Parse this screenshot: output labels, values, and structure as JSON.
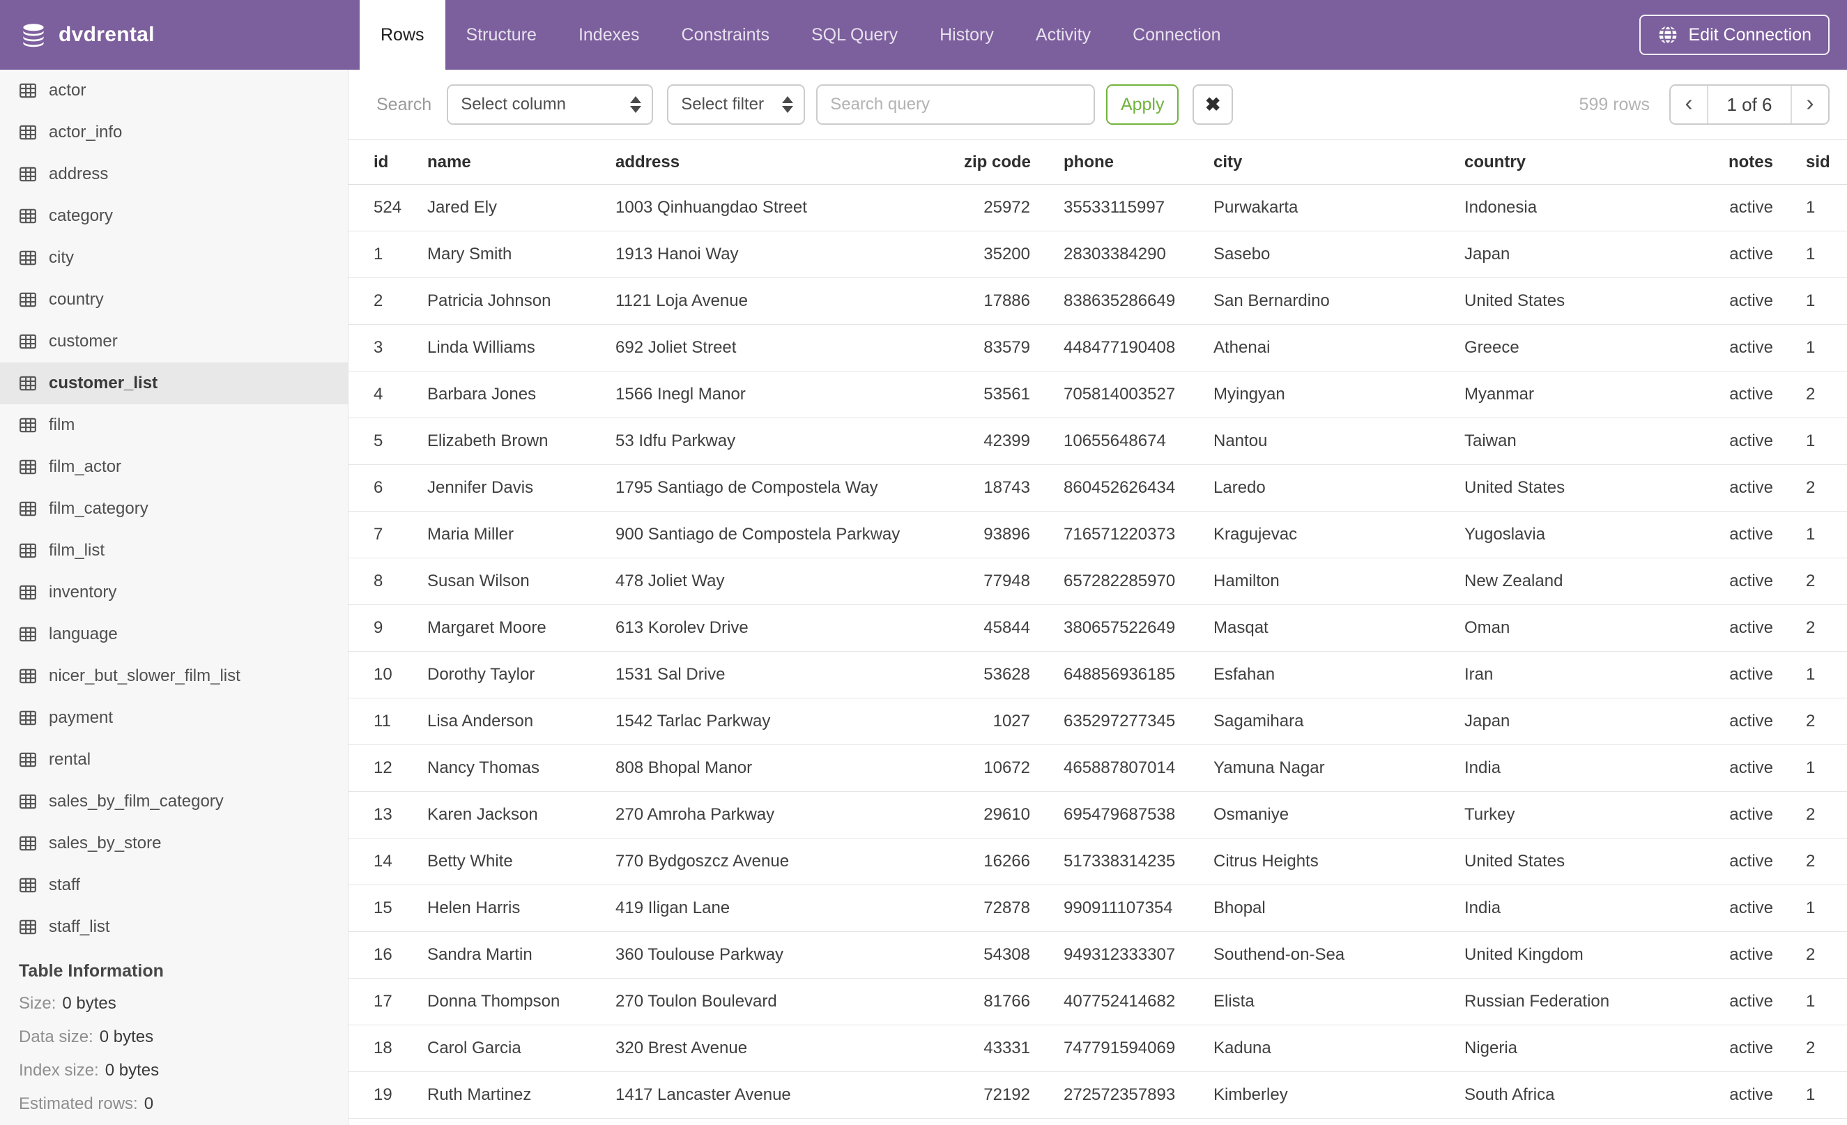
{
  "app": {
    "database_name": "dvdrental"
  },
  "topbar": {
    "tabs": [
      "Rows",
      "Structure",
      "Indexes",
      "Constraints",
      "SQL Query",
      "History",
      "Activity",
      "Connection"
    ],
    "active_tab": "Rows",
    "edit_connection_label": "Edit Connection"
  },
  "sidebar": {
    "tables": [
      "actor",
      "actor_info",
      "address",
      "category",
      "city",
      "country",
      "customer",
      "customer_list",
      "film",
      "film_actor",
      "film_category",
      "film_list",
      "inventory",
      "language",
      "nicer_but_slower_film_list",
      "payment",
      "rental",
      "sales_by_film_category",
      "sales_by_store",
      "staff",
      "staff_list"
    ],
    "selected_table": "customer_list",
    "info": {
      "title": "Table Information",
      "items": [
        {
          "label": "Size:",
          "value": "0 bytes"
        },
        {
          "label": "Data size:",
          "value": "0 bytes"
        },
        {
          "label": "Index size:",
          "value": "0 bytes"
        },
        {
          "label": "Estimated rows:",
          "value": "0"
        }
      ]
    }
  },
  "toolbar": {
    "search_label": "Search",
    "column_select_value": "Select column",
    "filter_select_value": "Select filter",
    "query_placeholder": "Search query",
    "query_value": "",
    "apply_label": "Apply",
    "clear_label": "✖",
    "rows_count": "599 rows",
    "page_indicator": "1 of 6",
    "prev_label": "‹",
    "next_label": "›"
  },
  "grid": {
    "columns": [
      "id",
      "name",
      "address",
      "zip code",
      "phone",
      "city",
      "country",
      "notes",
      "sid"
    ],
    "rows": [
      [
        "524",
        "Jared Ely",
        "1003 Qinhuangdao Street",
        "25972",
        "35533115997",
        "Purwakarta",
        "Indonesia",
        "active",
        "1"
      ],
      [
        "1",
        "Mary Smith",
        "1913 Hanoi Way",
        "35200",
        "28303384290",
        "Sasebo",
        "Japan",
        "active",
        "1"
      ],
      [
        "2",
        "Patricia Johnson",
        "1121 Loja Avenue",
        "17886",
        "838635286649",
        "San Bernardino",
        "United States",
        "active",
        "1"
      ],
      [
        "3",
        "Linda Williams",
        "692 Joliet Street",
        "83579",
        "448477190408",
        "Athenai",
        "Greece",
        "active",
        "1"
      ],
      [
        "4",
        "Barbara Jones",
        "1566 Inegl Manor",
        "53561",
        "705814003527",
        "Myingyan",
        "Myanmar",
        "active",
        "2"
      ],
      [
        "5",
        "Elizabeth Brown",
        "53 Idfu Parkway",
        "42399",
        "10655648674",
        "Nantou",
        "Taiwan",
        "active",
        "1"
      ],
      [
        "6",
        "Jennifer Davis",
        "1795 Santiago de Compostela Way",
        "18743",
        "860452626434",
        "Laredo",
        "United States",
        "active",
        "2"
      ],
      [
        "7",
        "Maria Miller",
        "900 Santiago de Compostela Parkway",
        "93896",
        "716571220373",
        "Kragujevac",
        "Yugoslavia",
        "active",
        "1"
      ],
      [
        "8",
        "Susan Wilson",
        "478 Joliet Way",
        "77948",
        "657282285970",
        "Hamilton",
        "New Zealand",
        "active",
        "2"
      ],
      [
        "9",
        "Margaret Moore",
        "613 Korolev Drive",
        "45844",
        "380657522649",
        "Masqat",
        "Oman",
        "active",
        "2"
      ],
      [
        "10",
        "Dorothy Taylor",
        "1531 Sal Drive",
        "53628",
        "648856936185",
        "Esfahan",
        "Iran",
        "active",
        "1"
      ],
      [
        "11",
        "Lisa Anderson",
        "1542 Tarlac Parkway",
        "1027",
        "635297277345",
        "Sagamihara",
        "Japan",
        "active",
        "2"
      ],
      [
        "12",
        "Nancy Thomas",
        "808 Bhopal Manor",
        "10672",
        "465887807014",
        "Yamuna Nagar",
        "India",
        "active",
        "1"
      ],
      [
        "13",
        "Karen Jackson",
        "270 Amroha Parkway",
        "29610",
        "695479687538",
        "Osmaniye",
        "Turkey",
        "active",
        "2"
      ],
      [
        "14",
        "Betty White",
        "770 Bydgoszcz Avenue",
        "16266",
        "517338314235",
        "Citrus Heights",
        "United States",
        "active",
        "2"
      ],
      [
        "15",
        "Helen Harris",
        "419 Iligan Lane",
        "72878",
        "990911107354",
        "Bhopal",
        "India",
        "active",
        "1"
      ],
      [
        "16",
        "Sandra Martin",
        "360 Toulouse Parkway",
        "54308",
        "949312333307",
        "Southend-on-Sea",
        "United Kingdom",
        "active",
        "2"
      ],
      [
        "17",
        "Donna Thompson",
        "270 Toulon Boulevard",
        "81766",
        "407752414682",
        "Elista",
        "Russian Federation",
        "active",
        "1"
      ],
      [
        "18",
        "Carol Garcia",
        "320 Brest Avenue",
        "43331",
        "747791594069",
        "Kaduna",
        "Nigeria",
        "active",
        "2"
      ],
      [
        "19",
        "Ruth Martinez",
        "1417 Lancaster Avenue",
        "72192",
        "272572357893",
        "Kimberley",
        "South Africa",
        "active",
        "1"
      ]
    ]
  },
  "colors": {
    "header_purple": "#7c5f9d",
    "apply_green": "#70b43c",
    "sidebar_bg": "#f7f7f7",
    "selected_item_bg": "#e8e8e8"
  }
}
